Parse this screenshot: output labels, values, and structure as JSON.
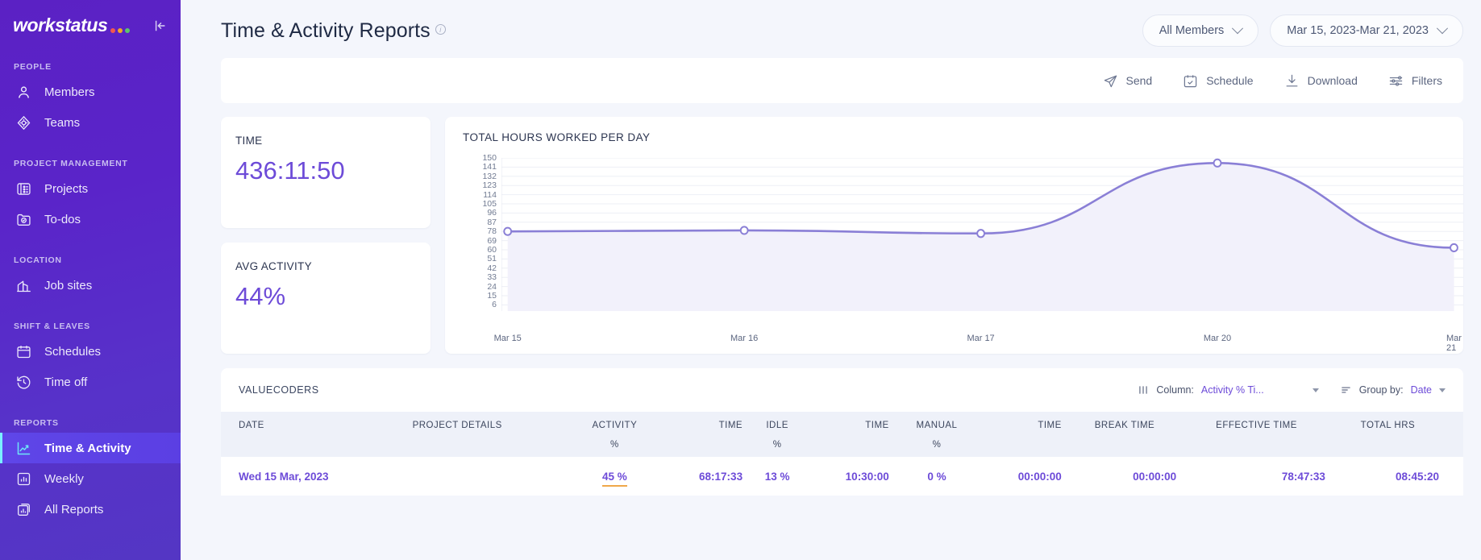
{
  "sidebar": {
    "logo_text": "workstatus",
    "logo_dots": [
      "#f2584f",
      "#f5a623",
      "#5cc46c"
    ],
    "collapse_icon": "collapse-panel-icon",
    "groups": [
      {
        "label": "PEOPLE",
        "items": [
          {
            "label": "Members",
            "icon": "user-icon",
            "active": false
          },
          {
            "label": "Teams",
            "icon": "teams-icon",
            "active": false
          }
        ]
      },
      {
        "label": "PROJECT MANAGEMENT",
        "items": [
          {
            "label": "Projects",
            "icon": "projects-icon",
            "active": false
          },
          {
            "label": "To-dos",
            "icon": "todos-icon",
            "active": false
          }
        ]
      },
      {
        "label": "LOCATION",
        "items": [
          {
            "label": "Job sites",
            "icon": "building-icon",
            "active": false
          }
        ]
      },
      {
        "label": "SHIFT & LEAVES",
        "items": [
          {
            "label": "Schedules",
            "icon": "calendar-icon",
            "active": false
          },
          {
            "label": "Time off",
            "icon": "clock-back-icon",
            "active": false
          }
        ]
      },
      {
        "label": "REPORTS",
        "items": [
          {
            "label": "Time & Activity",
            "icon": "line-chart-icon",
            "active": true
          },
          {
            "label": "Weekly",
            "icon": "bar-chart-icon",
            "active": false
          },
          {
            "label": "All Reports",
            "icon": "stacked-reports-icon",
            "active": false
          }
        ]
      }
    ]
  },
  "header": {
    "title": "Time & Activity Reports",
    "info_icon": "info-icon",
    "member_filter": "All Members",
    "date_range": "Mar 15, 2023-Mar 21, 2023"
  },
  "toolbar": {
    "actions": [
      {
        "label": "Send",
        "icon": "send-icon"
      },
      {
        "label": "Schedule",
        "icon": "calendar-check-icon"
      },
      {
        "label": "Download",
        "icon": "download-icon"
      },
      {
        "label": "Filters",
        "icon": "filters-icon"
      }
    ]
  },
  "stats": [
    {
      "label": "TIME",
      "value": "436:11:50"
    },
    {
      "label": "AVG ACTIVITY",
      "value": "44%"
    }
  ],
  "chart_data": {
    "type": "line",
    "title": "TOTAL HOURS WORKED PER DAY",
    "xlabel": "",
    "ylabel": "",
    "categories": [
      "Mar 15",
      "Mar 16",
      "Mar 17",
      "Mar 20",
      "Mar 21"
    ],
    "values": [
      78,
      79,
      76,
      145,
      62
    ],
    "ylim": [
      0,
      150
    ],
    "ytick_labels": [
      150,
      141,
      132,
      123,
      114,
      105,
      96,
      87,
      78,
      69,
      60,
      51,
      42,
      33,
      24,
      15,
      6
    ],
    "line_color": "#8a7fd6",
    "fill_color": "#f2f1fb",
    "marker": "open-circle",
    "grid": true,
    "legend": false
  },
  "table": {
    "group_title": "VALUECODERS",
    "controls": {
      "column_label": "Column:",
      "column_value": "Activity % Ti...",
      "column_icon": "columns-icon",
      "group_label": "Group by:",
      "group_value": "Date",
      "group_icon": "group-by-icon"
    },
    "columns": [
      {
        "group": "",
        "sub": "DATE",
        "align": "left"
      },
      {
        "group": "",
        "sub": "PROJECT DETAILS",
        "align": "left"
      },
      {
        "group": "ACTIVITY",
        "sub": "%",
        "align": "center"
      },
      {
        "group": "",
        "sub": "TIME",
        "align": "right"
      },
      {
        "group": "IDLE",
        "sub": "%",
        "align": "center"
      },
      {
        "group": "",
        "sub": "TIME",
        "align": "right"
      },
      {
        "group": "MANUAL",
        "sub": "%",
        "align": "center"
      },
      {
        "group": "",
        "sub": "TIME",
        "align": "right"
      },
      {
        "group": "BREAK TIME",
        "sub": "",
        "align": "right"
      },
      {
        "group": "EFFECTIVE TIME",
        "sub": "",
        "align": "right"
      },
      {
        "group": "TOTAL HRS",
        "sub": "",
        "align": "right"
      }
    ],
    "rows": [
      {
        "date": "Wed 15 Mar, 2023",
        "project_details": "",
        "activity_pct": "45 %",
        "activity_time": "68:17:33",
        "idle_pct": "13 %",
        "idle_time": "10:30:00",
        "manual_pct": "0 %",
        "manual_time": "00:00:00",
        "break_time": "00:00:00",
        "effective_time": "78:47:33",
        "total_hrs": "08:45:20"
      }
    ]
  }
}
